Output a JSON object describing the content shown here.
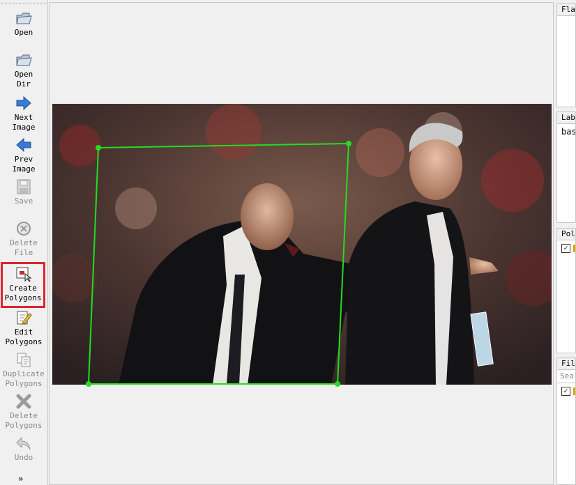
{
  "toolbar": {
    "open": "Open",
    "open_dir": "Open\nDir",
    "next_image": "Next\nImage",
    "prev_image": "Prev\nImage",
    "save": "Save",
    "delete_file": "Delete\nFile",
    "create_polygons": "Create\nPolygons",
    "edit_polygons": "Edit\nPolygons",
    "duplicate_polygons": "Duplicate\nPolygons",
    "delete_polygons": "Delete\nPolygons",
    "undo": "Undo",
    "more": "»"
  },
  "icons": {
    "open": "folder-icon",
    "open_dir": "folder-icon",
    "next_image": "arrow-right-icon",
    "prev_image": "arrow-left-icon",
    "save": "save-icon",
    "delete_file": "delete-circle-icon",
    "create_polygons": "create-polygon-icon",
    "edit_polygons": "edit-icon",
    "duplicate_polygons": "duplicate-icon",
    "delete_polygons": "cross-icon",
    "undo": "undo-icon"
  },
  "docks": {
    "flags_title": "Flags",
    "labels_title": "Label List",
    "label_item": "basketball",
    "polygons_title": "Polygon Labels",
    "files_title": "File List",
    "search_placeholder": "Search Filename"
  },
  "colors": {
    "selection_border": "#e0232f",
    "polygon": "#22dd22",
    "toolbar_bg": "#f0f0f0",
    "arrow_blue": "#3a7bd5"
  },
  "selected_tool": "create_polygons"
}
